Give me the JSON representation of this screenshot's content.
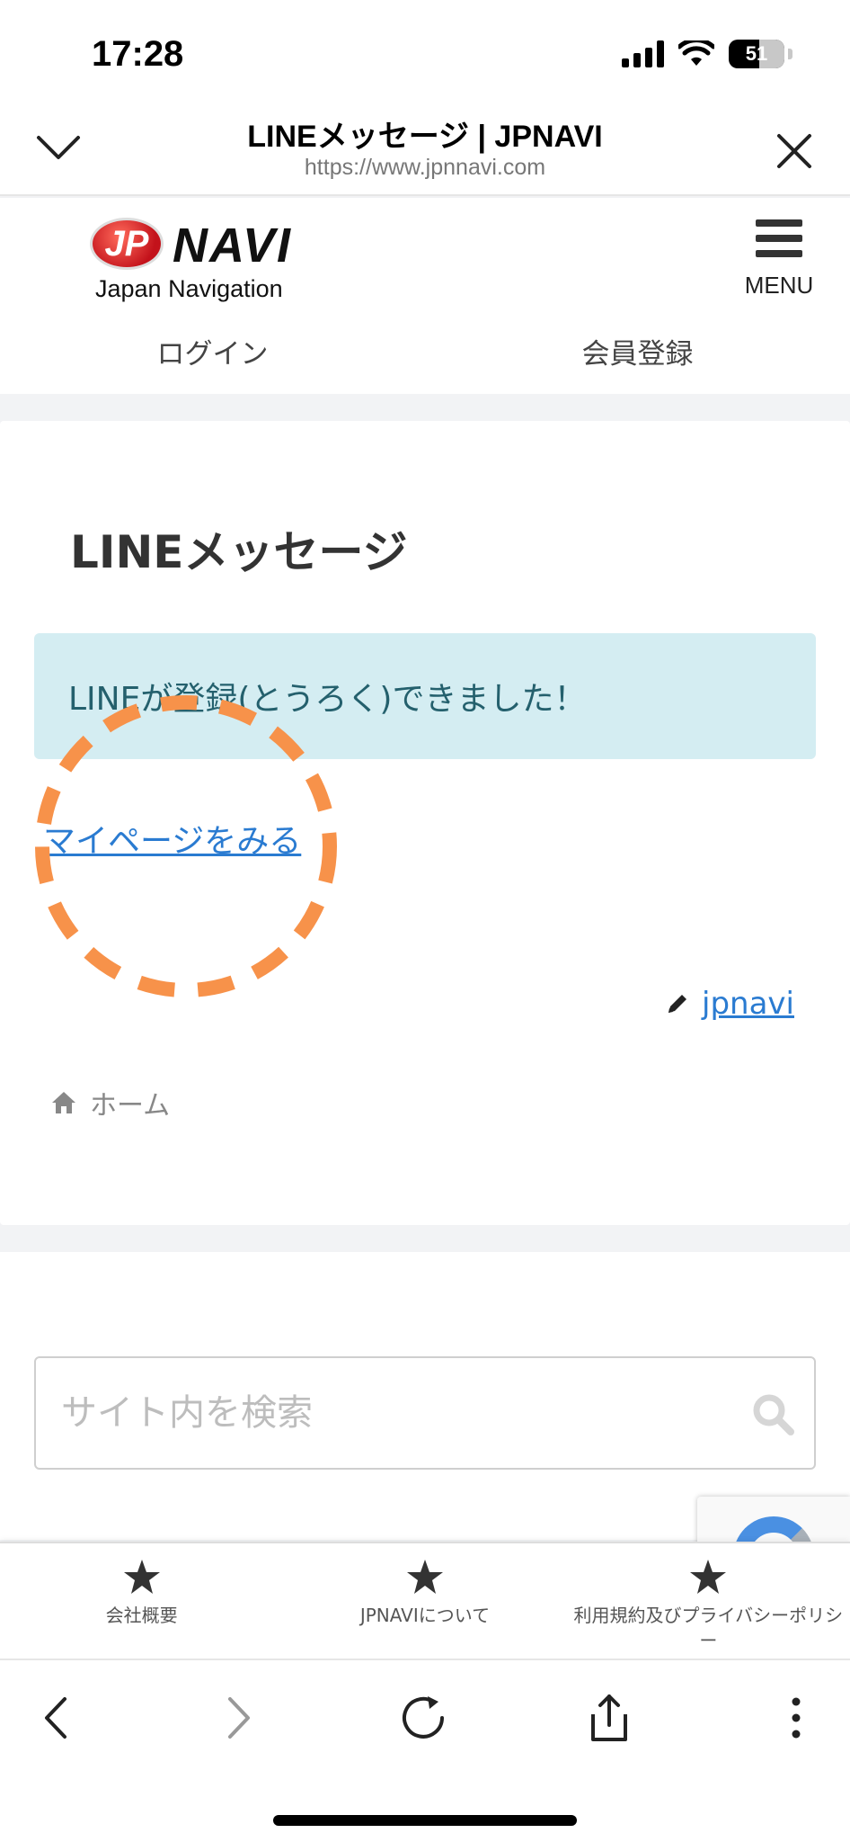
{
  "status_bar": {
    "time": "17:28",
    "battery": "51"
  },
  "browser": {
    "title": "LINEメッセージ | JPNAVI",
    "url": "https://www.jpnnavi.com"
  },
  "site": {
    "logo_mark": "JP",
    "logo_name": "NAVI",
    "logo_tagline": "Japan Navigation",
    "menu_label": "MENU"
  },
  "auth": {
    "login": "ログイン",
    "register": "会員登録"
  },
  "content": {
    "title": "LINEメッセージ",
    "alert": "LINEが登録(とうろく)できました！",
    "mypage_link": "マイページをみる",
    "author": "jpnavi",
    "breadcrumb_home": "ホーム"
  },
  "search": {
    "placeholder": "サイト内を検索"
  },
  "footer_nav": [
    {
      "label": "会社概要",
      "icon": "star-icon"
    },
    {
      "label": "JPNAVIについて",
      "icon": "star-icon"
    },
    {
      "label": "利用規約及びプライバシーポリシー",
      "icon": "star-icon"
    }
  ],
  "colors": {
    "link": "#2a7bd1",
    "alert_bg": "#d4edf2",
    "alert_text": "#24606d",
    "annotation": "#f7924a"
  }
}
